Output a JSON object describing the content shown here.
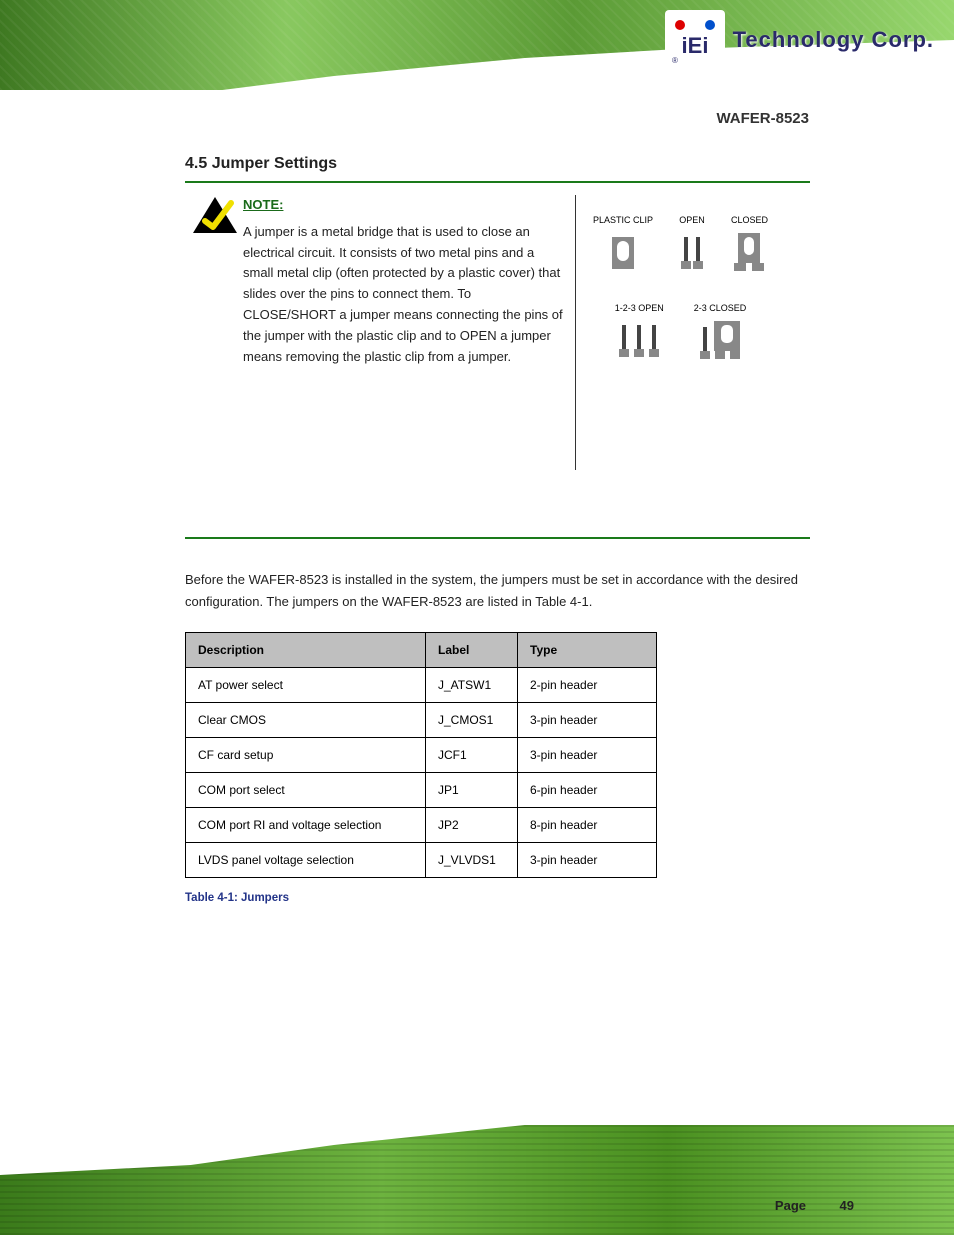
{
  "header": {
    "brand": "Technology Corp.",
    "logo_letters": "iEi",
    "product": "WAFER-8523"
  },
  "section": {
    "number": "4.5",
    "title": "Jumper Settings"
  },
  "note": {
    "heading": "NOTE:",
    "body": "A jumper is a metal bridge that is used to close an electrical circuit. It consists of two metal pins and a small metal clip (often protected by a plastic cover) that slides over the pins to connect them. To CLOSE/SHORT a jumper means connecting the pins of the jumper with the plastic clip and to OPEN a jumper means removing the plastic clip from a jumper."
  },
  "jumper_legend": {
    "plastic_clip": "PLASTIC CLIP",
    "open": "OPEN",
    "closed": "CLOSED",
    "open_123": "1-2-3 OPEN",
    "closed_23": "2-3 CLOSED"
  },
  "body_paragraph": "Before the WAFER-8523 is installed in the system, the jumpers must be set in accordance with the desired configuration. The jumpers on the WAFER-8523 are listed in Table 4-1.",
  "table": {
    "headers": [
      "Description",
      "Label",
      "Type"
    ],
    "rows": [
      [
        "AT power select",
        "J_ATSW1",
        "2-pin header"
      ],
      [
        "Clear CMOS",
        "J_CMOS1",
        "3-pin header"
      ],
      [
        "CF card setup",
        "JCF1",
        "3-pin header"
      ],
      [
        "COM port select",
        "JP1",
        "6-pin header"
      ],
      [
        "COM port RI and voltage selection",
        "JP2",
        "8-pin header"
      ],
      [
        "LVDS panel voltage selection",
        "J_VLVDS1",
        "3-pin header"
      ]
    ],
    "caption": "Table 4-1: Jumpers"
  },
  "footer": {
    "page_label": "Page",
    "page_number": "49"
  }
}
